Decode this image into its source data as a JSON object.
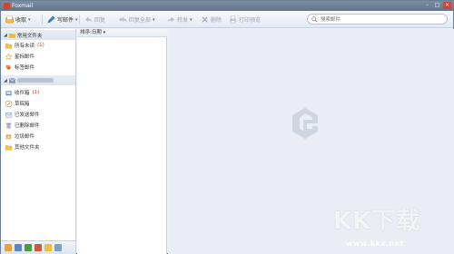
{
  "window": {
    "title": "Foxmail"
  },
  "toolbar": {
    "receive": "收取",
    "compose": "写邮件",
    "reply": "回复",
    "reply_all": "回复全部",
    "forward": "转发",
    "delete": "删除",
    "print_preview": "打印预览"
  },
  "search": {
    "placeholder": "搜索邮件"
  },
  "sidebar": {
    "common_group": "常用文件夹",
    "common_items": [
      {
        "label": "所有未读",
        "count": "(1)"
      },
      {
        "label": "星标邮件",
        "count": ""
      },
      {
        "label": "标签邮件",
        "count": ""
      }
    ],
    "account_items": [
      {
        "label": "收件箱",
        "count": "(1)"
      },
      {
        "label": "草稿箱",
        "count": ""
      },
      {
        "label": "已发送邮件",
        "count": ""
      },
      {
        "label": "已删除邮件",
        "count": ""
      },
      {
        "label": "垃圾邮件",
        "count": ""
      },
      {
        "label": "其他文件夹",
        "count": ""
      }
    ]
  },
  "list": {
    "sort_label": "排序:日期"
  },
  "watermark": {
    "big": "KK下载",
    "url": "www.kkx.net"
  },
  "colors": {
    "accent": "#4a78b5",
    "window_border": "#6c7e94",
    "unread": "#dd2222"
  }
}
